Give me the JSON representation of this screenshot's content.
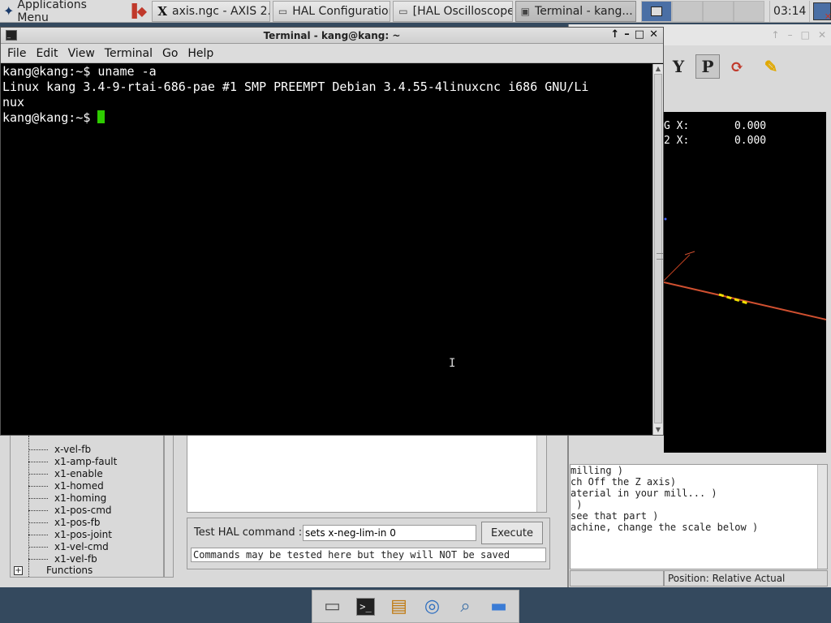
{
  "top_panel": {
    "app_menu_label": "Applications Menu",
    "tasks": [
      {
        "label": "axis.ngc - AXIS 2...",
        "icon": "x-logo-icon",
        "active": false
      },
      {
        "label": "HAL Configuration",
        "icon": "window-icon",
        "active": false
      },
      {
        "label": "[HAL Oscilloscope]",
        "icon": "window-icon",
        "active": false
      },
      {
        "label": "Terminal - kang...",
        "icon": "terminal-icon",
        "active": true
      }
    ],
    "clock": "03:14"
  },
  "terminal": {
    "title": "Terminal - kang@kang: ~",
    "menu": [
      {
        "label": "File"
      },
      {
        "label": "Edit"
      },
      {
        "label": "View"
      },
      {
        "label": "Terminal"
      },
      {
        "label": "Go"
      },
      {
        "label": "Help"
      }
    ],
    "lines": [
      "kang@kang:~$ uname -a",
      "Linux kang 3.4-9-rtai-686-pae #1 SMP PREEMPT Debian 3.4.55-4linuxcnc i686 GNU/Li",
      "nux",
      "kang@kang:~$ "
    ],
    "cursor_color": "#2ecc00"
  },
  "axis": {
    "dro": [
      {
        "label": "G X:",
        "value": "0.000"
      },
      {
        "label": "2 X:",
        "value": "0.000"
      }
    ],
    "log_lines": [
      "milling )",
      "ch Off the Z axis)",
      "aterial in your mill... )",
      " )",
      "see that part )",
      "achine, change the scale below )"
    ],
    "status_position": "Position: Relative Actual"
  },
  "hal": {
    "tree_items": [
      "x-vel-fb",
      "x1-amp-fault",
      "x1-enable",
      "x1-homed",
      "x1-homing",
      "x1-pos-cmd",
      "x1-pos-fb",
      "x1-pos-joint",
      "x1-vel-cmd",
      "x1-vel-fb"
    ],
    "tree_group": "Functions",
    "cmd_label": "Test HAL command :",
    "cmd_value": "sets x-neg-lim-in 0",
    "execute_label": "Execute",
    "note": "Commands may be tested here but they will NOT be saved"
  },
  "dock": [
    {
      "name": "show-desktop-icon",
      "glyph": "▭"
    },
    {
      "name": "terminal-icon",
      "glyph": ">_"
    },
    {
      "name": "file-cabinet-icon",
      "glyph": "▤"
    },
    {
      "name": "web-browser-icon",
      "glyph": "◎"
    },
    {
      "name": "search-icon",
      "glyph": "⌕"
    },
    {
      "name": "folder-icon",
      "glyph": "▬"
    }
  ]
}
